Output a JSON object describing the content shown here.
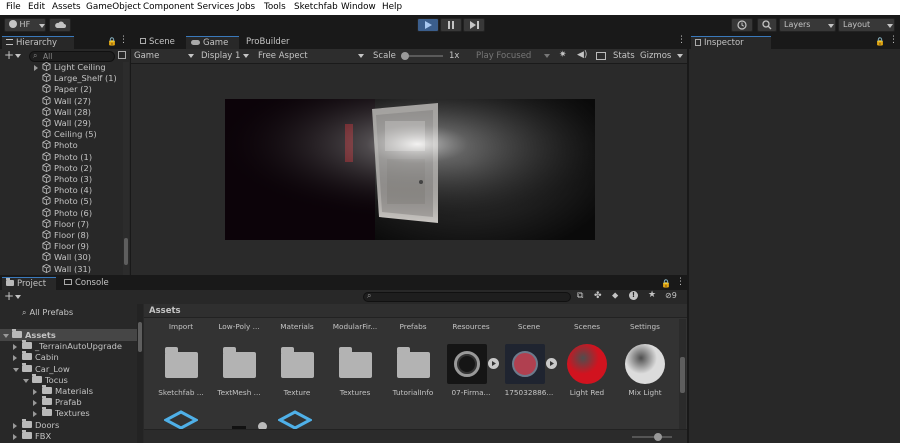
{
  "menu": [
    "File",
    "Edit",
    "Assets",
    "GameObject",
    "Component",
    "Services",
    "Jobs",
    "Tools",
    "Sketchfab",
    "Window",
    "Help"
  ],
  "toolbar": {
    "account": "HF",
    "layers": "Layers",
    "layout": "Layout"
  },
  "hierarchy": {
    "tab": "Hierarchy",
    "search_placeholder": "All",
    "items": [
      "Light Ceiling",
      "Large_Shelf (1)",
      "Paper (2)",
      "Wall (27)",
      "Wall (28)",
      "Wall (29)",
      "Ceiling (5)",
      "Photo",
      "Photo (1)",
      "Photo (2)",
      "Photo (3)",
      "Photo (4)",
      "Photo (5)",
      "Photo (6)",
      "Floor (7)",
      "Floor (8)",
      "Floor (9)",
      "Wall (30)",
      "Wall (31)"
    ]
  },
  "scene_tabs": {
    "scene": "Scene",
    "game": "Game",
    "probuilder": "ProBuilder"
  },
  "game_bar": {
    "mode": "Game",
    "display": "Display 1",
    "aspect": "Free Aspect",
    "scale_label": "Scale",
    "scale_value": "1x",
    "play_mode": "Play Focused",
    "stats": "Stats",
    "gizmos": "Gizmos"
  },
  "inspector": {
    "tab": "Inspector"
  },
  "project": {
    "tab_project": "Project",
    "tab_console": "Console",
    "hidden_count": "9",
    "favorites": "All Prefabs",
    "tree": [
      {
        "label": "Assets",
        "depth": 0,
        "expanded": true
      },
      {
        "label": "_TerrainAutoUpgrade",
        "depth": 1,
        "expanded": false
      },
      {
        "label": "Cabin",
        "depth": 1,
        "expanded": false
      },
      {
        "label": "Car_Low",
        "depth": 1,
        "expanded": true
      },
      {
        "label": "Tocus",
        "depth": 2,
        "expanded": true
      },
      {
        "label": "Materials",
        "depth": 3,
        "expanded": false
      },
      {
        "label": "Prafab",
        "depth": 3,
        "expanded": false
      },
      {
        "label": "Textures",
        "depth": 3,
        "expanded": false
      },
      {
        "label": "Doors",
        "depth": 1,
        "expanded": false
      },
      {
        "label": "FBX",
        "depth": 1,
        "expanded": false
      }
    ],
    "breadcrumb": "Assets",
    "row1": [
      "Import",
      "Low-Poly ...",
      "Materials",
      "ModularFir...",
      "Prefabs",
      "Resources",
      "Scene",
      "Scenes",
      "Settings"
    ],
    "row2": [
      "Sketchfab ...",
      "TextMesh ...",
      "Texture",
      "Textures",
      "TutorialInfo",
      "07-Firma...",
      "175032886...",
      "Light Red",
      "Mix Light"
    ]
  },
  "colors": {
    "accent": "#3a79bb",
    "play_active": "#3b5e8c",
    "light_red": "#d1131f",
    "mix_light": "#dcdcdc"
  }
}
